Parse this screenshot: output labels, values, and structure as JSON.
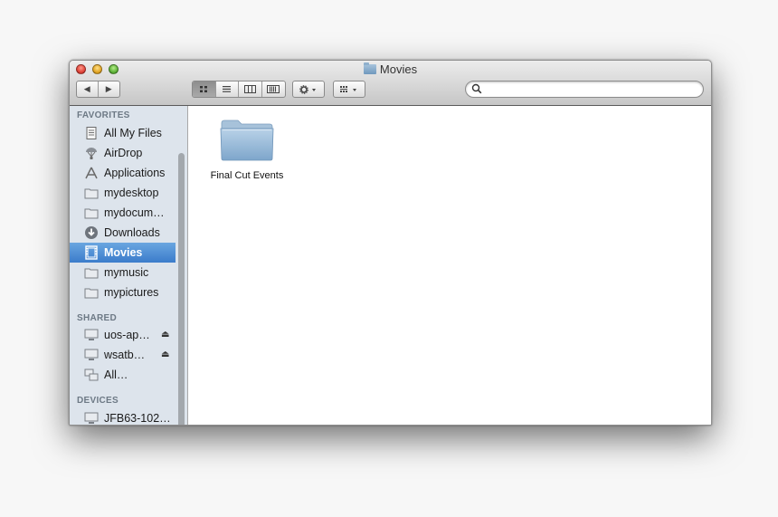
{
  "window": {
    "title": "Movies"
  },
  "toolbar": {
    "back": "◀",
    "forward": "▶",
    "view_icon": "icon-view-icon",
    "view_list": "list-view-icon",
    "view_column": "column-view-icon",
    "view_coverflow": "coverflow-view-icon",
    "action": "gear-icon",
    "arrange": "arrange-icon",
    "search_placeholder": "",
    "search_value": ""
  },
  "sidebar": {
    "favorites_header": "FAVORITES",
    "favorites": [
      {
        "label": "All My Files",
        "icon": "all-my-files-icon"
      },
      {
        "label": "AirDrop",
        "icon": "airdrop-icon"
      },
      {
        "label": "Applications",
        "icon": "applications-icon"
      },
      {
        "label": "mydesktop",
        "icon": "folder-icon"
      },
      {
        "label": "mydocum…",
        "icon": "folder-icon"
      },
      {
        "label": "Downloads",
        "icon": "downloads-icon"
      },
      {
        "label": "Movies",
        "icon": "movies-icon",
        "selected": true
      },
      {
        "label": "mymusic",
        "icon": "folder-icon"
      },
      {
        "label": "mypictures",
        "icon": "folder-icon"
      }
    ],
    "shared_header": "SHARED",
    "shared": [
      {
        "label": "uos-ap…",
        "icon": "computer-icon",
        "eject": "⏏"
      },
      {
        "label": "wsatb…",
        "icon": "computer-icon",
        "eject": "⏏"
      },
      {
        "label": "All…",
        "icon": "network-icon"
      }
    ],
    "devices_header": "DEVICES",
    "devices": [
      {
        "label": "JFB63-102…",
        "icon": "computer-icon"
      }
    ]
  },
  "content": {
    "items": [
      {
        "name": "Final Cut Events",
        "icon": "folder-icon"
      }
    ]
  },
  "colors": {
    "selection": "#3b7ccb",
    "sidebar_bg": "#dde4ec",
    "folder": "#8fb3d4"
  }
}
